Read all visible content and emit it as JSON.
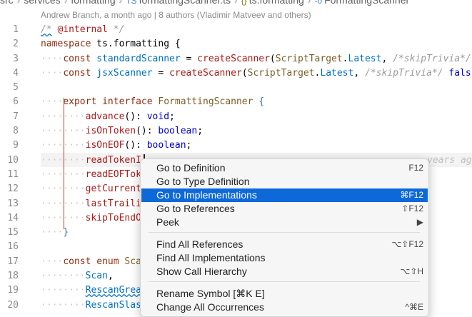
{
  "breadcrumb": {
    "seg1": "src",
    "seg2": "services",
    "seg3": "formatting",
    "seg4_icon": "TS",
    "seg4": "formattingScanner.ts",
    "seg5_icon": "{}",
    "seg5": "ts.formatting",
    "seg6_icon": "-o",
    "seg6": "FormattingScanner"
  },
  "blame": "Andrew Branch, a month ago | 8 authors (Vladimir Matveev and others)",
  "code": {
    "l1_cm1": "/*",
    "l1_tag": "@internal",
    "l1_cm2": "*/",
    "l2_kw": "namespace",
    "l2_name": "ts.formatting {",
    "l3_kw": "const",
    "l3_var": "standardScanner",
    "l3_eq": " = ",
    "l3_fn": "createScanner",
    "l3_p": "(",
    "l3_ty": "ScriptTarget",
    "l3_dot": ".",
    "l3_latest": "Latest",
    "l3_rest": ", ",
    "l3_cm": "/*skipTrivia*/",
    "l4_kw": "const",
    "l4_var": "jsxScanner",
    "l4_eq": " = ",
    "l4_fn": "createScanner",
    "l4_p": "(",
    "l4_ty": "ScriptTarget",
    "l4_dot": ".",
    "l4_latest": "Latest",
    "l4_rest": ", ",
    "l4_cm": "/*skipTrivia*/",
    "l4_tail": " fals",
    "l6_kw1": "export",
    "l6_kw2": "interface",
    "l6_name": "FormattingScanner",
    "l6_brace": "{",
    "l7_prop": "advance",
    "l7_rest": "(): ",
    "l7_ty": "void",
    "l7_end": ";",
    "l8_prop": "isOnToken",
    "l8_rest": "(): ",
    "l8_ty": "boolean",
    "l8_end": ";",
    "l9_prop": "isOnEOF",
    "l9_rest": "(): ",
    "l9_ty": "boolean",
    "l9_end": ";",
    "l10_prop": "readTokenI",
    "l10_ghost": "years ago",
    "l11_prop": "readEOFTok",
    "l12_prop": "getCurrent",
    "l13_prop": "lastTraili",
    "l14_prop": "skipToEndO",
    "l15_brace": "}",
    "l17_kw1": "const",
    "l17_kw2": "enum",
    "l17_name": "Sca",
    "l18_enum": "Scan",
    "l18_end": ",",
    "l19_enum": "RescanGrea",
    "l20_enum": "RescanSlas"
  },
  "line_numbers": [
    "1",
    "2",
    "3",
    "4",
    "5",
    "6",
    "7",
    "8",
    "9",
    "10",
    "11",
    "12",
    "13",
    "14",
    "15",
    "16",
    "17",
    "18",
    "19",
    "20"
  ],
  "context_menu": {
    "items": [
      {
        "label": "Go to Definition",
        "shortcut": "F12"
      },
      {
        "label": "Go to Type Definition",
        "shortcut": ""
      },
      {
        "label": "Go to Implementations",
        "shortcut": "⌘F12"
      },
      {
        "label": "Go to References",
        "shortcut": "⇧F12"
      },
      {
        "label": "Peek",
        "shortcut": "▶"
      },
      {
        "label": "Find All References",
        "shortcut": "⌥⇧F12"
      },
      {
        "label": "Find All Implementations",
        "shortcut": ""
      },
      {
        "label": "Show Call Hierarchy",
        "shortcut": "⌥⇧H"
      },
      {
        "label": "Rename Symbol [⌘K E]",
        "shortcut": ""
      },
      {
        "label": "Change All Occurrences",
        "shortcut": "^⌘E"
      }
    ],
    "selected_index": 2
  },
  "colors": {
    "selection": "#0d68d8",
    "indent_guide": "#c23b22",
    "keyword": "#8e2a0f"
  }
}
